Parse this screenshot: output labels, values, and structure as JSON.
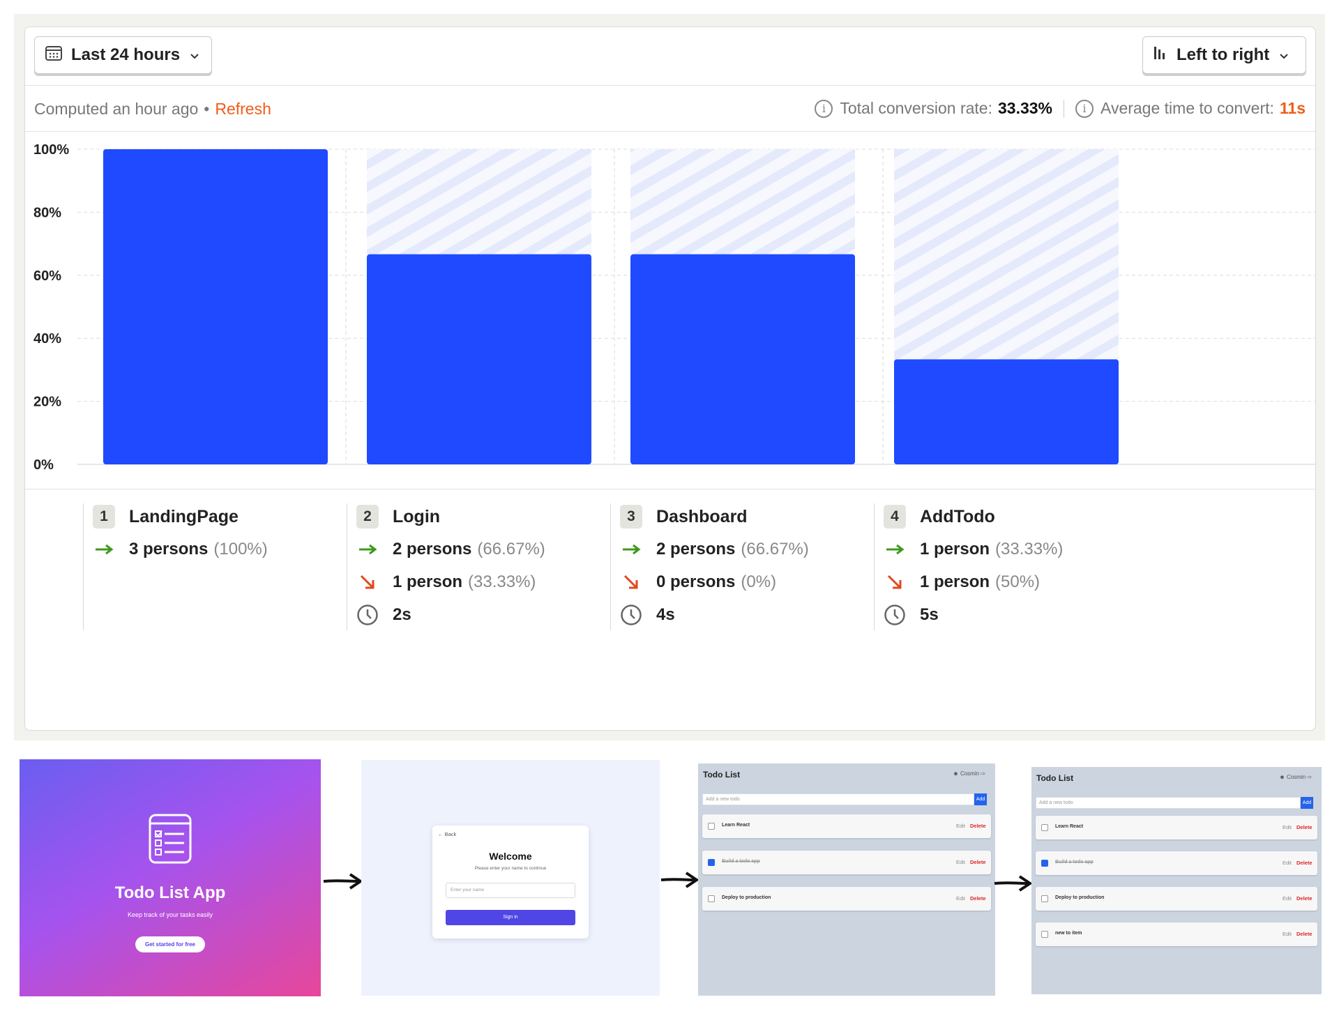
{
  "toolbar": {
    "range_label": "Last 24 hours",
    "direction_label": "Left to right"
  },
  "status": {
    "computed": "Computed an hour ago",
    "dot": "•",
    "refresh": "Refresh",
    "total_label": "Total conversion rate:",
    "total_value": "33.33%",
    "avg_label": "Average time to convert:",
    "avg_value": "11s"
  },
  "colors": {
    "bar": "#1f4aff",
    "bar_remainder": "#e6ebfc",
    "accent": "#f05c19",
    "up_arrow": "#3d9a1d",
    "down_arrow": "#e0481e"
  },
  "chart_data": {
    "type": "bar",
    "categories": [
      "LandingPage",
      "Login",
      "Dashboard",
      "AddTodo"
    ],
    "values": [
      100,
      66.67,
      66.67,
      33.33
    ],
    "ylim": [
      0,
      100
    ],
    "ytick_labels": [
      "0%",
      "20%",
      "40%",
      "60%",
      "80%",
      "100%"
    ],
    "yticks": [
      0,
      20,
      40,
      60,
      80,
      100
    ],
    "grid": true
  },
  "steps": [
    {
      "num": "1",
      "name": "LandingPage",
      "converted": "3 persons",
      "converted_pct": "(100%)"
    },
    {
      "num": "2",
      "name": "Login",
      "converted": "2 persons",
      "converted_pct": "(66.67%)",
      "dropped": "1 person",
      "dropped_pct": "(33.33%)",
      "time": "2s"
    },
    {
      "num": "3",
      "name": "Dashboard",
      "converted": "2 persons",
      "converted_pct": "(66.67%)",
      "dropped": "0 persons",
      "dropped_pct": "(0%)",
      "time": "4s"
    },
    {
      "num": "4",
      "name": "AddTodo",
      "converted": "1 person",
      "converted_pct": "(33.33%)",
      "dropped": "1 person",
      "dropped_pct": "(50%)",
      "time": "5s"
    }
  ],
  "screens": {
    "landing": {
      "title": "Todo List App",
      "subtitle": "Keep track of your tasks easily",
      "cta": "Get started for free"
    },
    "login": {
      "back": "← Back",
      "title": "Welcome",
      "subtitle": "Please enter your name to continue",
      "placeholder": "Enter your name",
      "button": "Sign in"
    },
    "dashboard": {
      "title": "Todo List",
      "user": "Cosmin",
      "placeholder": "Add a new todo",
      "add": "Add",
      "edit": "Edit",
      "delete": "Delete",
      "items": [
        "Learn React",
        "Build a todo app",
        "Deploy to production"
      ]
    },
    "addtodo": {
      "title": "Todo List",
      "user": "Cosmin",
      "placeholder": "Add a new todo",
      "add": "Add",
      "edit": "Edit",
      "delete": "Delete",
      "items": [
        "Learn React",
        "Build a todo app",
        "Deploy to production",
        "new to item"
      ]
    }
  }
}
